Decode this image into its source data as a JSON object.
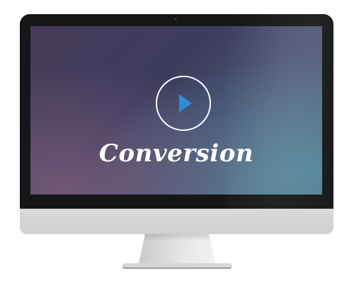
{
  "video": {
    "title": "Conversion",
    "play_icon": "play-icon"
  },
  "colors": {
    "bezel": "#151617",
    "play_accent": "#2a8fd6",
    "chin": "#d9dadb"
  }
}
